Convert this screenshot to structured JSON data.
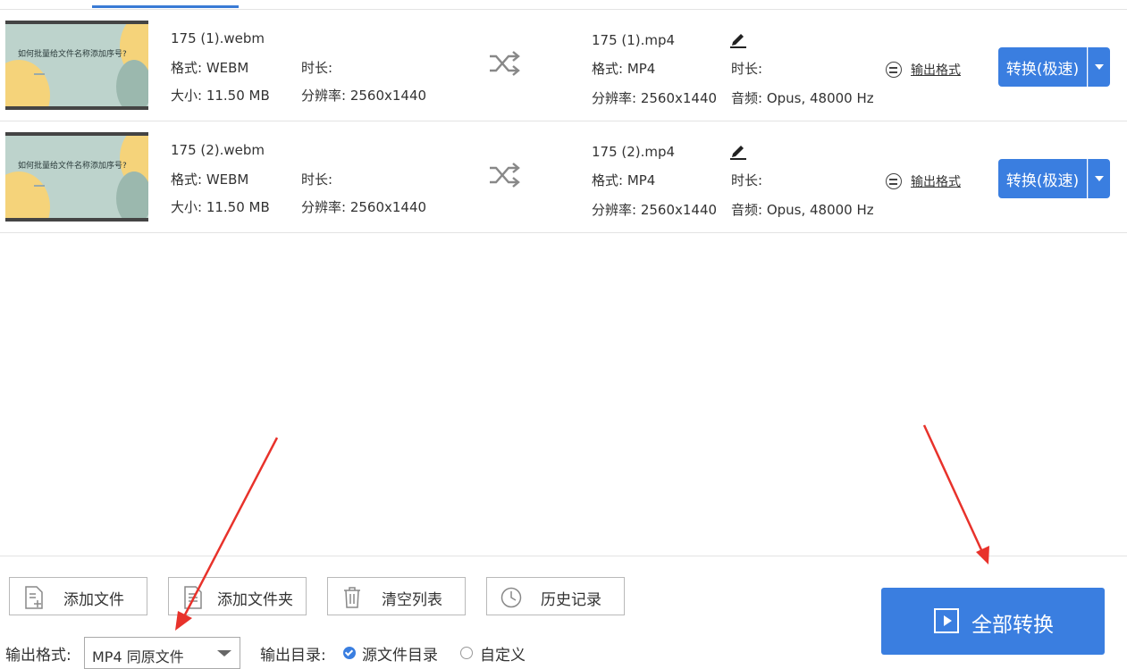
{
  "files": [
    {
      "thumbnail_title": "如何批量给文件名称添加序号?",
      "name": "175 (1).webm",
      "format": "格式: WEBM",
      "duration": "时长:",
      "size": "大小: 11.50 MB",
      "resolution": "分辨率: 2560x1440",
      "output_name": "175 (1).mp4",
      "output_format": "格式: MP4",
      "output_duration": "时长:",
      "output_resolution": "分辨率: 2560x1440",
      "output_audio": "音频: Opus, 48000 Hz",
      "format_link": "输出格式",
      "convert_label": "转换(极速)"
    },
    {
      "thumbnail_title": "如何批量给文件名称添加序号?",
      "name": "175 (2).webm",
      "format": "格式: WEBM",
      "duration": "时长:",
      "size": "大小: 11.50 MB",
      "resolution": "分辨率: 2560x1440",
      "output_name": "175 (2).mp4",
      "output_format": "格式: MP4",
      "output_duration": "时长:",
      "output_resolution": "分辨率: 2560x1440",
      "output_audio": "音频: Opus, 48000 Hz",
      "format_link": "输出格式",
      "convert_label": "转换(极速)"
    }
  ],
  "toolbar": {
    "add_file": "添加文件",
    "add_folder": "添加文件夹",
    "clear_list": "清空列表",
    "history": "历史记录"
  },
  "output": {
    "format_label": "输出格式:",
    "format_value": "MP4 同原文件",
    "dir_label": "输出目录:",
    "dir_source": "源文件目录",
    "dir_custom": "自定义",
    "selected_dir": "源文件目录"
  },
  "convert_all": "全部转换",
  "colors": {
    "accent": "#3a7ee0",
    "annotation_arrow": "#e8322b"
  }
}
